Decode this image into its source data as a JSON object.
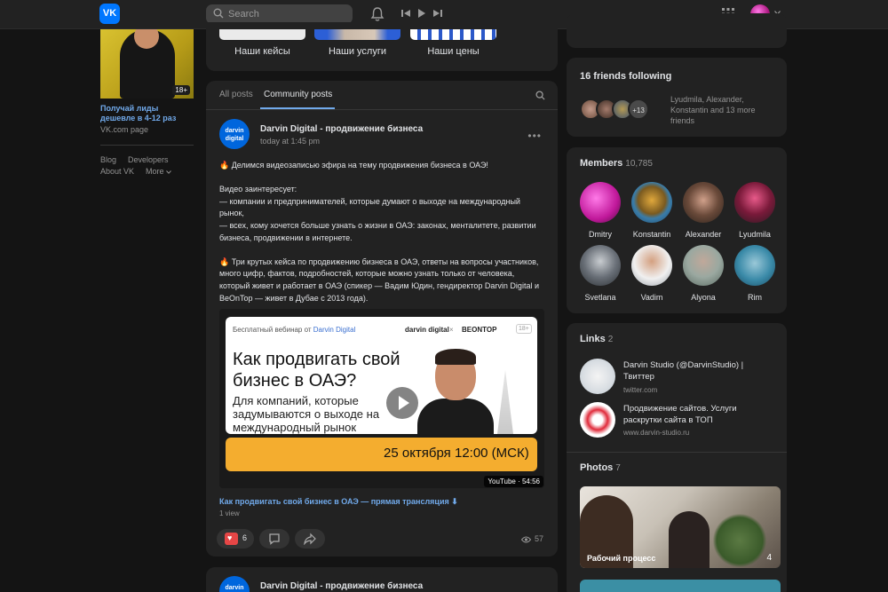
{
  "topbar": {
    "logo_text": "VK",
    "search_placeholder": "Search"
  },
  "left": {
    "ad_badge": "18+",
    "ad_title": "Получай лиды дешевле в 4-12 раз",
    "ad_source": "VK.com page",
    "footer_links": [
      "Blog",
      "Developers",
      "About VK",
      "More"
    ]
  },
  "top_buttons": [
    "Наши кейсы",
    "Наши услуги",
    "Наши цены"
  ],
  "tabs": {
    "all_posts": "All posts",
    "community_posts": "Community posts"
  },
  "post": {
    "avatar_text": "darvin digital",
    "author": "Darvin Digital - продвижение бизнеса",
    "time": "today at 1:45 pm",
    "text": "🔥 Делимся видеозаписью эфира на тему продвижения бизнеса в ОАЭ!\n\nВидео заинтересует:\n— компании и предпринимателей, которые думают о выходе на международный рынок,\n— всех, кому хочется больше узнать о жизни в ОАЭ: законах, менталитете, развитии бизнеса, продвижении в интернете.\n\n🔥 Три крутых кейса по продвижению бизнеса в ОАЭ, ответы на вопросы участников, много цифр, фактов, подробностей, которые можно узнать только от человека, который живет и работает в ОАЭ (спикер — Вадим Юдин, гендиректор Darvin Digital и BeOnTop — живет в Дубае с 2013 года).",
    "video": {
      "tag_prefix": "Бесплатный вебинар от ",
      "tag_brand": "Darvin Digital",
      "brand1": "darvin digital",
      "brand_sep": "×",
      "brand2": "BEONTOP",
      "age": "18+",
      "headline": "Как продвигать свой бизнес в ОАЭ?",
      "subline": "Для компаний, которые задумываются о выходе на международный рынок",
      "date": "25 октября   12:00 (МСК)",
      "duration": "YouTube · 54:56"
    },
    "video_title": "Как продвигать свой бизнес в ОАЭ — прямая трансляция ⬇",
    "video_views": "1 view",
    "likes": "6",
    "views": "57"
  },
  "post2": {
    "avatar_text": "darvin digital",
    "author": "Darvin Digital - продвижение бизнеса"
  },
  "right": {
    "friends": {
      "title": "16 friends following",
      "more": "+13",
      "text": "Lyudmila, Alexander, Konstantin and 13 more friends"
    },
    "members": {
      "title": "Members",
      "count": "10,785",
      "names": [
        "Dmitry",
        "Konstantin",
        "Alexander",
        "Lyudmila",
        "Svetlana",
        "Vadim",
        "Alyona",
        "Rim"
      ]
    },
    "links": {
      "title": "Links",
      "count": "2",
      "items": [
        {
          "title": "Darvin Studio (@DarvinStudio) | Твиттер",
          "url": "twitter.com"
        },
        {
          "title": "Продвижение сайтов. Услуги раскрутки сайта в ТОП",
          "url": "www.darvin-studio.ru"
        }
      ]
    },
    "photos": {
      "title": "Photos",
      "count": "7",
      "caption": "Рабочий процесс",
      "number": "4"
    }
  },
  "colors": {
    "accent": "#71aaeb",
    "like": "#e64646",
    "background": "#141414",
    "card": "#222222"
  }
}
